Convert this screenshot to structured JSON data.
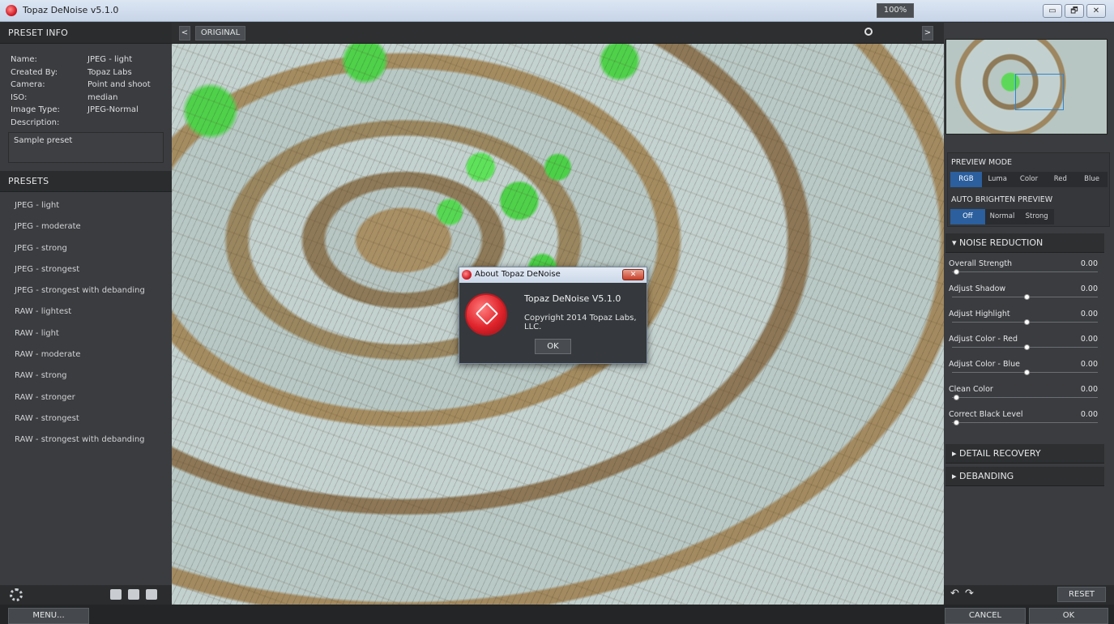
{
  "window": {
    "title": "Topaz DeNoise v5.1.0",
    "controls": [
      "▭",
      "🗗",
      "✕"
    ]
  },
  "preset_info": {
    "heading": "PRESET INFO",
    "rows": [
      {
        "key": "Name:",
        "value": "JPEG - light"
      },
      {
        "key": "Created By:",
        "value": "Topaz Labs"
      },
      {
        "key": "Camera:",
        "value": "Point and shoot"
      },
      {
        "key": "ISO:",
        "value": "median"
      },
      {
        "key": "Image Type:",
        "value": "JPEG-Normal"
      },
      {
        "key": "Description:",
        "value": ""
      }
    ],
    "description": "Sample preset"
  },
  "presets": {
    "heading": "PRESETS",
    "items": [
      "JPEG - light",
      "JPEG - moderate",
      "JPEG - strong",
      "JPEG - strongest",
      "JPEG - strongest with debanding",
      "RAW - lightest",
      "RAW - light",
      "RAW - moderate",
      "RAW - strong",
      "RAW - stronger",
      "RAW - strongest",
      "RAW - strongest with debanding"
    ]
  },
  "preview_toolbar": {
    "prev_arrow": "<",
    "original_label": "ORIGINAL",
    "zoom": "100%",
    "next_arrow": ">"
  },
  "about_dialog": {
    "title": "About Topaz DeNoise",
    "close": "✕",
    "product": "Topaz DeNoise V5.1.0",
    "copyright": "Copyright 2014 Topaz Labs, LLC.",
    "ok_label": "OK"
  },
  "preview_mode": {
    "heading": "PREVIEW MODE",
    "options": [
      "RGB",
      "Luma",
      "Color",
      "Red",
      "Blue"
    ],
    "selected": "RGB"
  },
  "auto_brighten": {
    "heading": "AUTO BRIGHTEN PREVIEW",
    "options": [
      "Off",
      "Normal",
      "Strong"
    ],
    "selected": "Off"
  },
  "noise_reduction": {
    "heading": "▾ NOISE REDUCTION",
    "sliders": [
      {
        "label": "Overall Strength",
        "value": "0.00",
        "level": 0.0
      },
      {
        "label": "Adjust Shadow",
        "value": "0.00",
        "level": 0.5
      },
      {
        "label": "Adjust Highlight",
        "value": "0.00",
        "level": 0.5
      },
      {
        "label": "Adjust Color - Red",
        "value": "0.00",
        "level": 0.5
      },
      {
        "label": "Adjust Color - Blue",
        "value": "0.00",
        "level": 0.5
      },
      {
        "label": "Clean Color",
        "value": "0.00",
        "level": 0.0
      },
      {
        "label": "Correct Black Level",
        "value": "0.00",
        "level": 0.0
      }
    ]
  },
  "detail_recovery": {
    "heading": "▸ DETAIL RECOVERY"
  },
  "debanding": {
    "heading": "▸ DEBANDING"
  },
  "right_footer": {
    "undo": "↶",
    "redo": "↷",
    "reset_label": "RESET"
  },
  "bottom_bar": {
    "menu_label": "MENU...",
    "cancel_label": "CANCEL",
    "ok_label": "OK"
  },
  "colors": {
    "accent": "#2b5f9e",
    "brand": "#d21f28"
  }
}
